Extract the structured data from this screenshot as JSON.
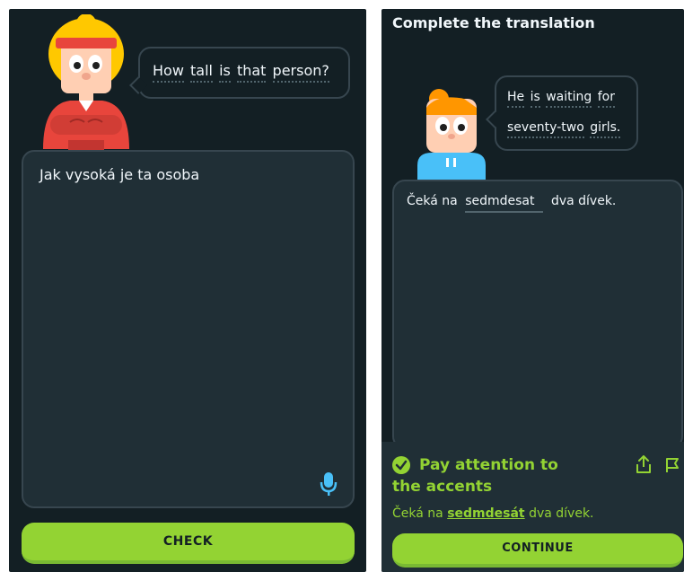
{
  "left": {
    "bubble_words": [
      "How",
      "tall",
      "is",
      "that",
      "person?"
    ],
    "answer_text": "Jak vysoká je ta osoba",
    "check_label": "CHECK",
    "mic_icon": "microphone-icon"
  },
  "right": {
    "title": "Complete the translation",
    "bubble_line1": [
      "He",
      "is",
      "waiting",
      "for"
    ],
    "bubble_line2": [
      "seventy-two",
      "girls."
    ],
    "sentence_before": "Čeká na",
    "input_value": "sedmdesat",
    "sentence_after": "dva dívek.",
    "feedback_title_line1": "Pay attention to",
    "feedback_title_line2": "the accents",
    "correction_before": "Čeká na ",
    "correction_highlight": "sedmdesát",
    "correction_after": " dva dívek.",
    "continue_label": "CONTINUE",
    "share_icon": "share-icon",
    "flag_icon": "flag-icon",
    "check_icon": "check-circle-icon"
  },
  "colors": {
    "background": "#131f24",
    "panel": "#202f36",
    "border": "#37464f",
    "green": "#93d333",
    "text": "#f1f7fb",
    "mic": "#49c0f8"
  }
}
